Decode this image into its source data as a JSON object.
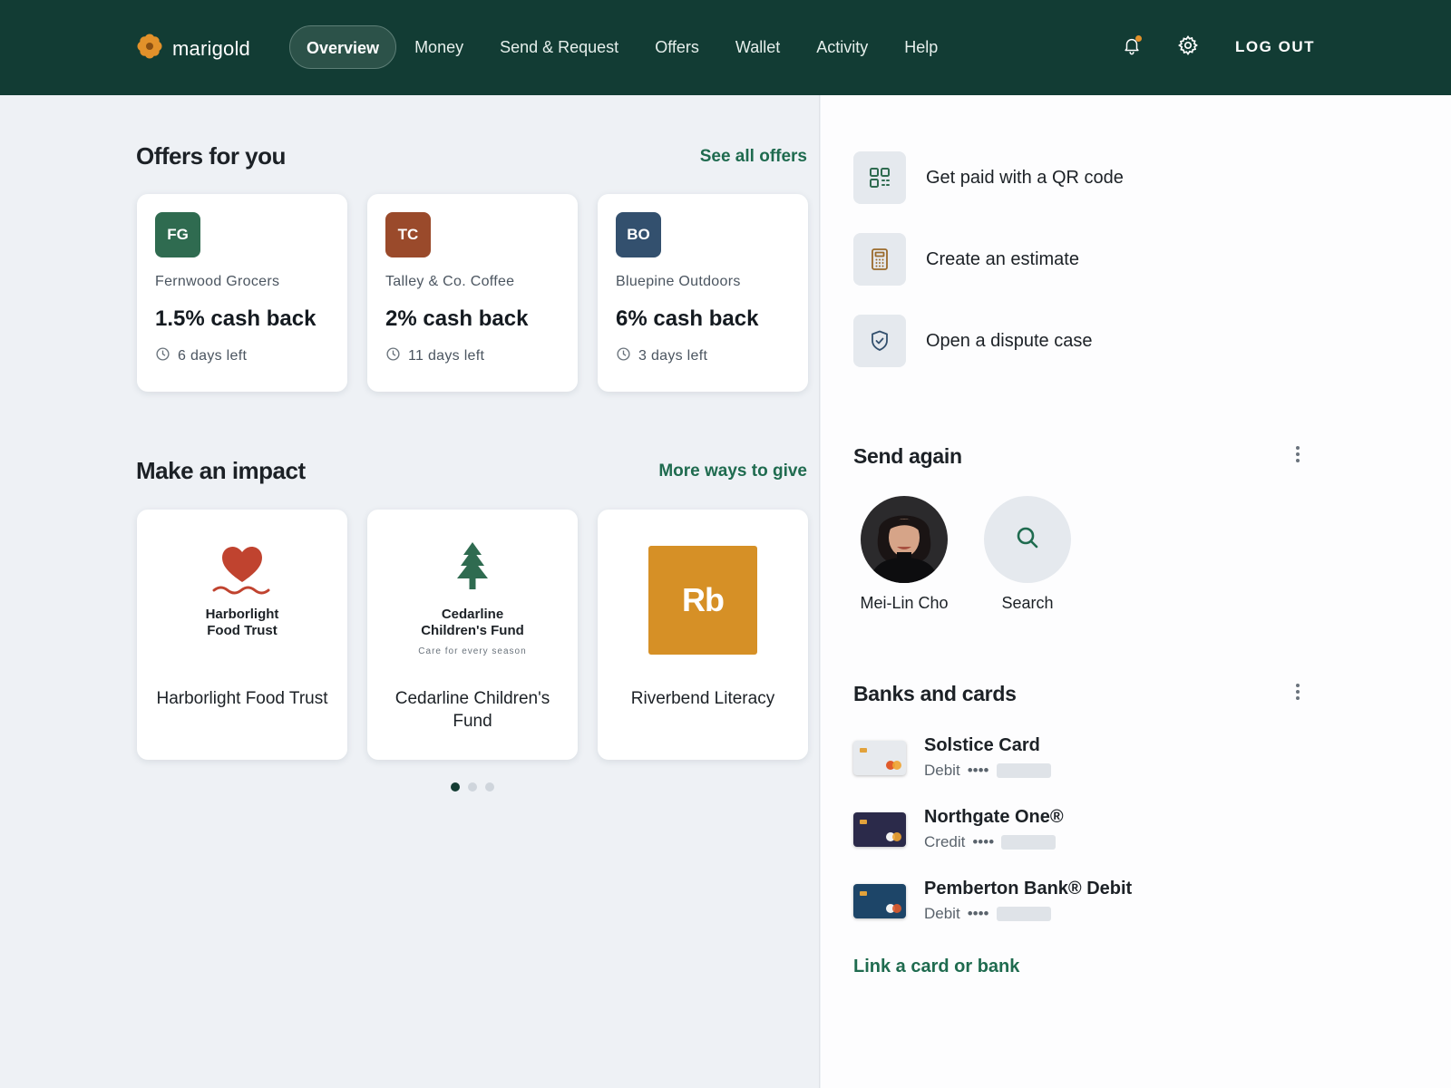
{
  "brand": {
    "name": "marigold",
    "color": "#e2912a"
  },
  "nav": {
    "items": [
      {
        "label": "Overview",
        "active": true
      },
      {
        "label": "Money"
      },
      {
        "label": "Send & Request"
      },
      {
        "label": "Offers"
      },
      {
        "label": "Wallet"
      },
      {
        "label": "Activity"
      },
      {
        "label": "Help"
      }
    ],
    "logout_label": "LOG OUT",
    "icons": [
      "bell-icon",
      "gear-icon"
    ]
  },
  "offers": {
    "title": "Offers for you",
    "link": "See all offers",
    "items": [
      {
        "initials": "FG",
        "merchant": "Fernwood Grocers",
        "value": "1.5% cash back",
        "time_left": "6 days left",
        "color": "#2f6b50"
      },
      {
        "initials": "TC",
        "merchant": "Talley & Co. Coffee",
        "value": "2% cash back",
        "time_left": "11 days left",
        "color": "#9a4a2b"
      },
      {
        "initials": "BO",
        "merchant": "Bluepine Outdoors",
        "value": "6% cash back",
        "time_left": "3 days left",
        "color": "#33506e"
      }
    ]
  },
  "impact": {
    "title": "Make an impact",
    "link": "More ways to give",
    "items": [
      {
        "logo_title": "Harborlight Food Trust",
        "name": "Harborlight Food Trust"
      },
      {
        "logo_title": "Cedarline Children's Fund",
        "logo_tagline": "Care for every season",
        "name": "Cedarline Children's Fund"
      },
      {
        "logo_text": "Rb",
        "name": "Riverbend Literacy"
      }
    ],
    "pager": {
      "count": 3,
      "active_index": 0
    }
  },
  "quick_actions": [
    {
      "label": "Get paid with a QR code",
      "icon": "qr-code-icon"
    },
    {
      "label": "Create an estimate",
      "icon": "calculator-icon"
    },
    {
      "label": "Open a dispute case",
      "icon": "shield-check-icon"
    }
  ],
  "send_again": {
    "title": "Send again",
    "contacts": [
      {
        "label": "Mei-Lin Cho"
      },
      {
        "label": "Search"
      }
    ]
  },
  "banks": {
    "title": "Banks and cards",
    "items": [
      {
        "name": "Solstice Card",
        "type": "Debit",
        "mask": "••••",
        "card_color": "#e7eaee"
      },
      {
        "name": "Northgate One®",
        "type": "Credit",
        "mask": "••••",
        "card_color": "#2b2a4a"
      },
      {
        "name": "Pemberton Bank® Debit",
        "type": "Debit",
        "mask": "••••",
        "card_color": "#1d4568"
      }
    ],
    "link": "Link a card or bank"
  }
}
